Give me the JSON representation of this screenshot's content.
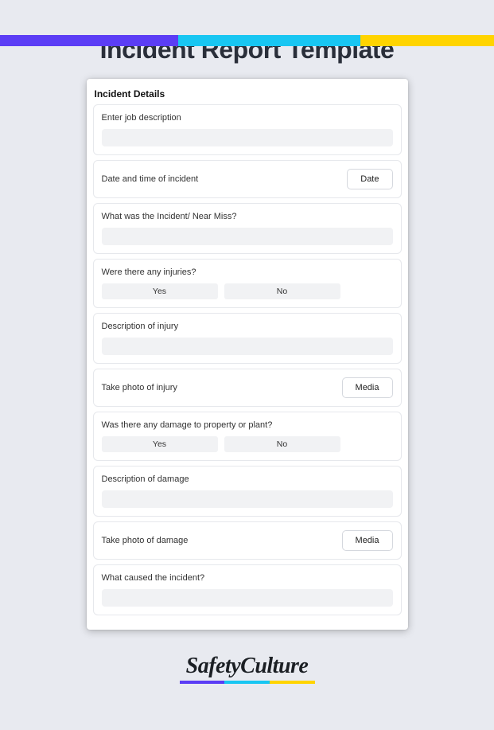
{
  "title": "Incident Report Template",
  "section": {
    "heading": "Incident Details"
  },
  "fields": {
    "job_desc": {
      "label": "Enter job description"
    },
    "datetime": {
      "label": "Date and time of incident",
      "button": "Date"
    },
    "incident": {
      "label": "What was the Incident/ Near Miss?"
    },
    "injuries": {
      "label": "Were there any injuries?",
      "yes": "Yes",
      "no": "No"
    },
    "injury_desc": {
      "label": "Description of injury"
    },
    "injury_photo": {
      "label": "Take photo of injury",
      "button": "Media"
    },
    "property": {
      "label": "Was there any damage to property or plant?",
      "yes": "Yes",
      "no": "No"
    },
    "damage_desc": {
      "label": "Description of damage"
    },
    "damage_photo": {
      "label": "Take photo of damage",
      "button": "Media"
    },
    "cause": {
      "label": "What caused the incident?"
    }
  },
  "brand": "SafetyCulture"
}
